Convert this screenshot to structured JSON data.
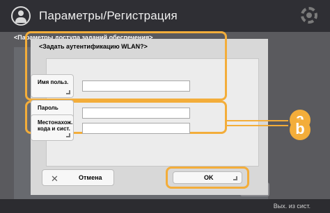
{
  "header": {
    "title": "Параметры/Регистрация"
  },
  "background": {
    "heading": "<Параметры доступа заданий обеспечения>",
    "bottom_link": "Вых. из сист."
  },
  "dialog": {
    "heading": "<Задать аутентификацию WLAN?>",
    "fields": [
      {
        "label": "Имя польз.",
        "value": ""
      },
      {
        "label": "Пароль",
        "value": ""
      },
      {
        "label": "Местонахож. кода и сист.",
        "value": ""
      }
    ],
    "cancel_label": "Отмена",
    "ok_label": "OK"
  },
  "callouts": [
    "a",
    "b"
  ],
  "colors": {
    "highlight": "#f3ad3a",
    "titlebar": "#2f2f34",
    "dim": "#5a5a5e"
  },
  "icons": [
    "user-icon",
    "gear-icon",
    "close-icon"
  ]
}
